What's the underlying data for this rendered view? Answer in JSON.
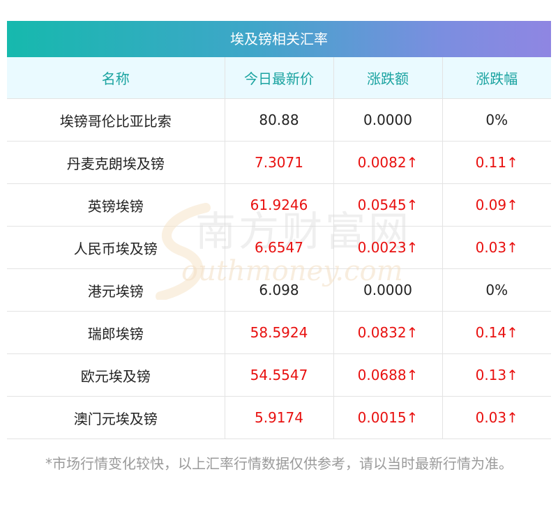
{
  "title": "埃及镑相关汇率",
  "headers": [
    "名称",
    "今日最新价",
    "涨跌额",
    "涨跌幅"
  ],
  "rows": [
    {
      "name": "埃镑哥伦比亚比索",
      "price": "80.88",
      "change": "0.0000",
      "pct": "0%",
      "up": false
    },
    {
      "name": "丹麦克朗埃及镑",
      "price": "7.3071",
      "change": "0.0082↑",
      "pct": "0.11↑",
      "up": true
    },
    {
      "name": "英镑埃镑",
      "price": "61.9246",
      "change": "0.0545↑",
      "pct": "0.09↑",
      "up": true
    },
    {
      "name": "人民币埃及镑",
      "price": "6.6547",
      "change": "0.0023↑",
      "pct": "0.03↑",
      "up": true
    },
    {
      "name": "港元埃镑",
      "price": "6.098",
      "change": "0.0000",
      "pct": "0%",
      "up": false
    },
    {
      "name": "瑞郎埃镑",
      "price": "58.5924",
      "change": "0.0832↑",
      "pct": "0.14↑",
      "up": true
    },
    {
      "name": "欧元埃及镑",
      "price": "54.5547",
      "change": "0.0688↑",
      "pct": "0.13↑",
      "up": true
    },
    {
      "name": "澳门元埃及镑",
      "price": "5.9174",
      "change": "0.0015↑",
      "pct": "0.03↑",
      "up": true
    }
  ],
  "footnote": "*市场行情变化较快，以上汇率行情数据仅供参考，请以当时最新行情为准。",
  "watermark": {
    "cn": "南方财富网",
    "en": "outhmoney.com"
  },
  "colors": {
    "up": "#e8100f",
    "header_text": "#1aa3a0",
    "header_bg": "#eafaff"
  }
}
